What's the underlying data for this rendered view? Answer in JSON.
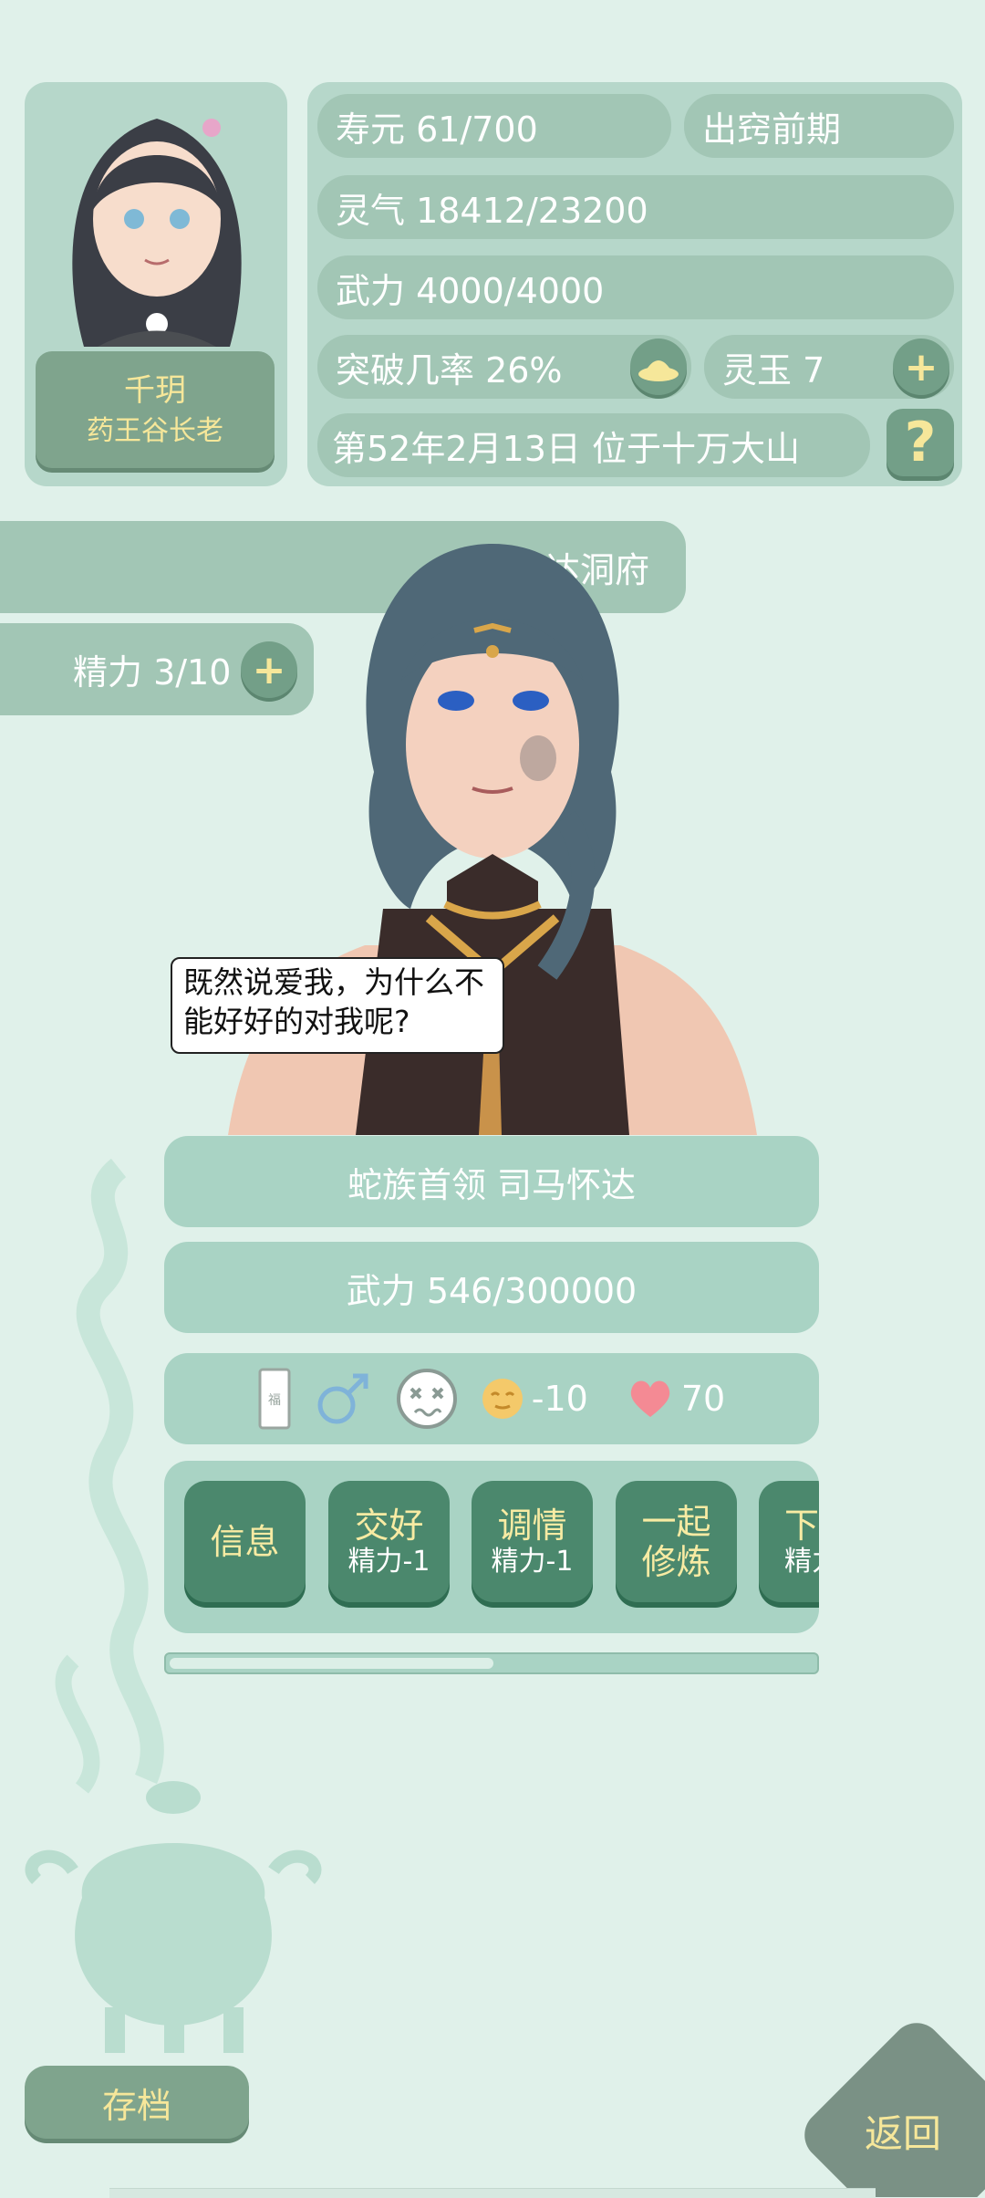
{
  "player": {
    "name": "千玥",
    "title": "药王谷长老"
  },
  "stats": {
    "lifespan": "寿元 61/700",
    "realm": "出窍前期",
    "spirit": "灵气 18412/23200",
    "force": "武力 4000/4000",
    "breakthrough": "突破几率 26%",
    "jade": "灵玉 7",
    "date_location": "第52年2月13日 位于十万大山",
    "help": "?"
  },
  "location": {
    "label": "达洞府"
  },
  "energy": {
    "label": "精力 3/10"
  },
  "npc": {
    "speech": "既然说爱我，为什么不能好好的对我呢?",
    "name": "蛇族首领 司马怀达",
    "force": "武力 546/300000",
    "mood_value": "-10",
    "affection": "70"
  },
  "actions": [
    {
      "title": "信息",
      "cost": ""
    },
    {
      "title": "交好",
      "cost": "精力-1"
    },
    {
      "title": "调情",
      "cost": "精力-1"
    },
    {
      "title": "一起",
      "title2": "修炼",
      "cost": ""
    },
    {
      "title": "下",
      "cost": "精力"
    }
  ],
  "scroll": {
    "position": 0.5
  },
  "footer": {
    "save": "存档",
    "back": "返回"
  },
  "colors": {
    "accent": "#4b886d",
    "highlight": "#f6e79a",
    "panel": "#b6d7ca",
    "pill": "#a2c6b5",
    "heart": "#f48a94"
  }
}
